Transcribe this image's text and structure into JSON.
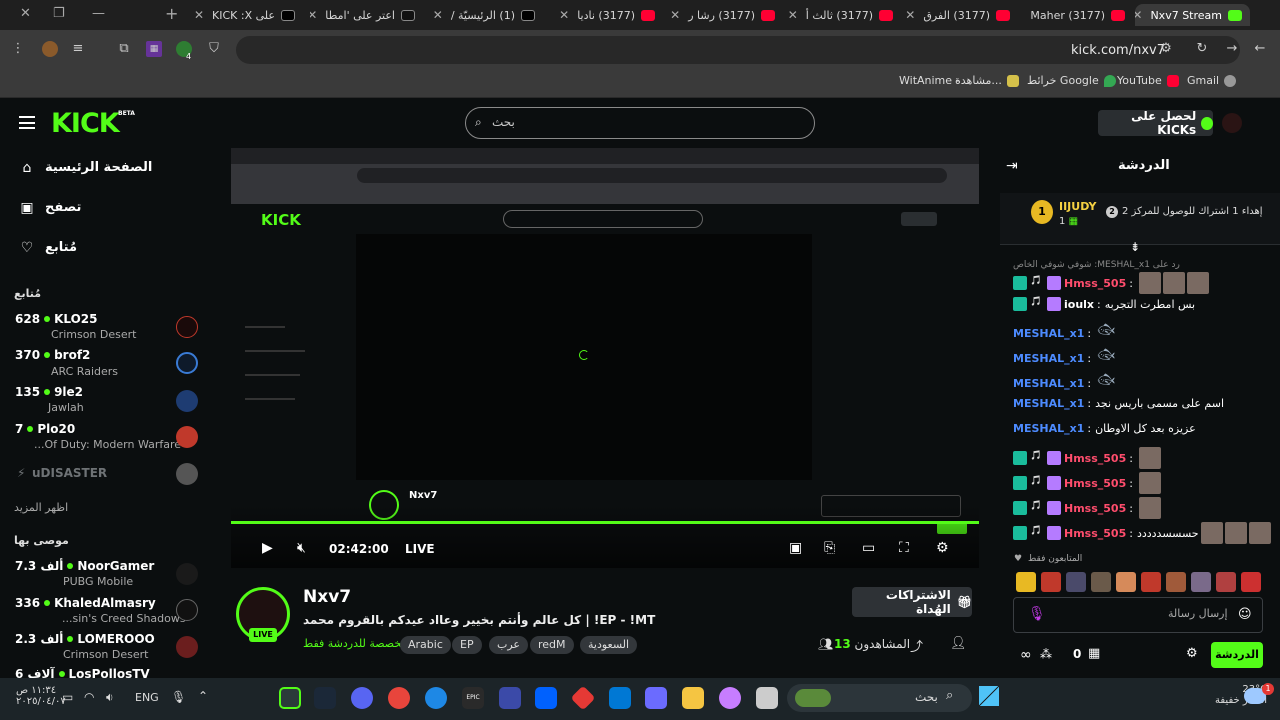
{
  "browser": {
    "tabs": [
      {
        "label": "Nxv7 Stream",
        "active": true
      },
      {
        "label": "(3177) Maher"
      },
      {
        "label": "(3177) الفرق"
      },
      {
        "label": "(3177) ثالث أ"
      },
      {
        "label": "(3177) رشا ر"
      },
      {
        "label": "(3177) ناديا"
      },
      {
        "label": "(1) الرئيسيّة /"
      },
      {
        "label": "اعتر على 'امطا"
      },
      {
        "label": "على KICK :X"
      }
    ],
    "url": "kick.com/nxv7",
    "bookmarks": [
      "Gmail",
      "YouTube",
      "خرائط Google",
      "مشاهدة...",
      "WitAnime -"
    ],
    "extension_badge": "4"
  },
  "header": {
    "logo": "KICK",
    "beta": "BETA",
    "search_placeholder": "بحث",
    "get_kicks": "لحصل على KICKs"
  },
  "sidebar": {
    "nav": [
      {
        "label": "الصفحة الرئيسية",
        "icon": "home-icon"
      },
      {
        "label": "تصفح",
        "icon": "browse-icon"
      },
      {
        "label": "مُتابع",
        "icon": "heart-icon"
      }
    ],
    "following_header": "مُتابع",
    "following": [
      {
        "count": "628",
        "name": "KLO25",
        "category": "Crimson Desert",
        "color": "#c0392b"
      },
      {
        "count": "370",
        "name": "brof2",
        "category": "ARC Raiders",
        "color": "#3a7bd5"
      },
      {
        "count": "135",
        "name": "9le2",
        "category": "Jawlah",
        "color": "#1e3c72"
      },
      {
        "count": "7",
        "name": "Plo20",
        "category": "...Of Duty: Modern Warfare",
        "color": "#c0392b"
      }
    ],
    "offline_name": "uDISASTER",
    "show_more": "اظهر المزيد",
    "recommended_header": "موصى بها",
    "recommended": [
      {
        "count": "7.3 ألف",
        "name": "NoorGamer",
        "category": "PUBG Mobile"
      },
      {
        "count": "336",
        "name": "KhaledAlmasry",
        "category": "...sin's Creed Shadows"
      },
      {
        "count": "2.3 ألف",
        "name": "LOMEROOO",
        "category": "Crimson Desert"
      },
      {
        "count": "6 آلاف",
        "name": "LosPollosTV",
        "category": ""
      }
    ]
  },
  "player": {
    "time": "02:42:00",
    "live": "LIVE",
    "progress_fraction": 1.0
  },
  "stream": {
    "streamer": "Nxv7",
    "live_badge": "LIVE",
    "title": "كل عالم وأنتم بخيير وعااد عيدكم بالقروم محمد | !EP - !MT",
    "category": "مخصصة للدردشة فقط",
    "tags": [
      "Arabic",
      "EP",
      "عرب",
      "redM",
      "السعودية"
    ],
    "subscribe_gifts": "الاشتراكات الهُداة",
    "viewers_label": "المشاهدون",
    "viewers_count": "13"
  },
  "chat": {
    "title": "الدردشة",
    "pinned_user": "IIJUDY",
    "pinned_rank": "1",
    "pinned_count": "1",
    "pinned_text": "إهداء 1 اشتراك للوصول للمركز 2",
    "pinned_place": "2",
    "reply_context": "رد على MESHAL_x1: شوفي شوفي الخاص",
    "messages": [
      {
        "user": "Hmss_505",
        "text": "",
        "color": "#ff4d6d",
        "emotes": 3
      },
      {
        "user": "ioulx",
        "text": "بس امطرت التجربه",
        "color": "#ffffff",
        "emotes": 0
      },
      {
        "user": "MESHAL_x1",
        "text": "",
        "color": "#4d8bff",
        "emotes": 1
      },
      {
        "user": "MESHAL_x1",
        "text": "",
        "color": "#4d8bff",
        "emotes": 1
      },
      {
        "user": "MESHAL_x1",
        "text": "",
        "color": "#4d8bff",
        "emotes": 1
      },
      {
        "user": "MESHAL_x1",
        "text": "اسم على مسمى باريس نجد",
        "color": "#4d8bff",
        "emotes": 0
      },
      {
        "user": "MESHAL_x1",
        "text": "عزيزه بعد كل الاوطان",
        "color": "#4d8bff",
        "emotes": 0
      },
      {
        "user": "Hmss_505",
        "text": "",
        "color": "#ff4d6d",
        "emotes": 1
      },
      {
        "user": "Hmss_505",
        "text": "",
        "color": "#ff4d6d",
        "emotes": 1
      },
      {
        "user": "Hmss_505",
        "text": "",
        "color": "#ff4d6d",
        "emotes": 1
      },
      {
        "user": "Hmss_505",
        "text": "حسسسددددد",
        "color": "#ff4d6d",
        "emotes": 3
      }
    ],
    "followers_only": "المتابعون فقط",
    "input_placeholder": "إرسال رسالة",
    "send_label": "الدردشة",
    "kicks_balance": "0"
  },
  "taskbar": {
    "weather_temp": "23°C",
    "weather_desc": "أمطار خفيفة",
    "search_placeholder": "بحث",
    "lang": "ENG",
    "time": "١١:٣٤ ص",
    "date": "٢٠٢٥/٠٤/٠٧",
    "notif_count": "1"
  }
}
